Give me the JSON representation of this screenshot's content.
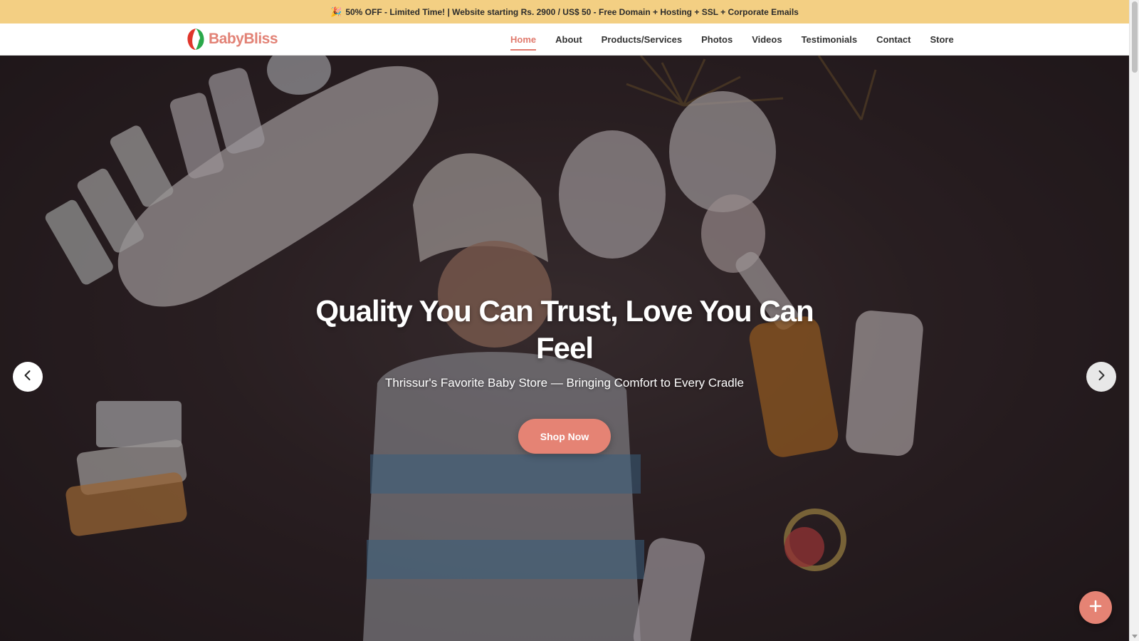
{
  "promo": {
    "icon": "party-popper-icon",
    "text": "50% OFF - Limited Time! | Website starting Rs. 2900 / US$ 50 - Free Domain + Hosting + SSL + Corporate Emails"
  },
  "brand": {
    "name": "BabyBliss",
    "accent": "#e07a6d",
    "logo_colors": [
      "#e0352b",
      "#2aa84a"
    ]
  },
  "nav": {
    "items": [
      {
        "label": "Home",
        "active": true
      },
      {
        "label": "About",
        "active": false
      },
      {
        "label": "Products/Services",
        "active": false
      },
      {
        "label": "Photos",
        "active": false
      },
      {
        "label": "Videos",
        "active": false
      },
      {
        "label": "Testimonials",
        "active": false
      },
      {
        "label": "Contact",
        "active": false
      },
      {
        "label": "Store",
        "active": false
      }
    ]
  },
  "hero": {
    "title": "Quality You Can Trust, Love You Can Feel",
    "subtitle": "Thrissur's Favorite Baby Store — Bringing Comfort to Every Cradle",
    "cta_label": "Shop Now",
    "cta_color": "#e58374",
    "prev_icon": "chevron-left-icon",
    "next_icon": "chevron-right-icon"
  },
  "fab": {
    "icon": "plus-icon",
    "color": "#e58374"
  }
}
